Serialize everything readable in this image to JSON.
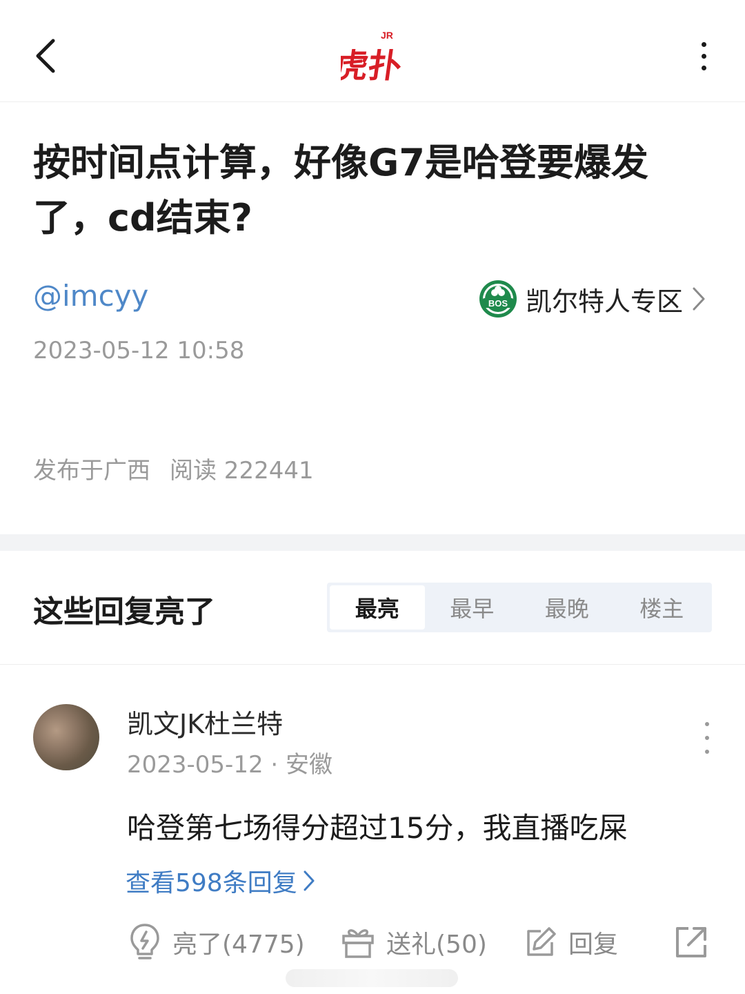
{
  "header": {
    "back_icon": "chevron-left-icon",
    "logo_text": "虎扑",
    "logo_superscript": "JR",
    "more_icon": "more-vertical-icon"
  },
  "post": {
    "title": "按时间点计算，好像G7是哈登要爆发了，cd结束?",
    "author": "@imcyy",
    "forum": {
      "name": "凯尔特人专区",
      "badge_text": "BOS"
    },
    "time": "2023-05-12 10:58",
    "location": "发布于广西",
    "views": "阅读 222441"
  },
  "replies_section": {
    "title": "这些回复亮了",
    "tabs": [
      {
        "label": "最亮",
        "active": true
      },
      {
        "label": "最早",
        "active": false
      },
      {
        "label": "最晚",
        "active": false
      },
      {
        "label": "楼主",
        "active": false
      }
    ]
  },
  "comment": {
    "username": "凯文JK杜兰特",
    "meta": "2023-05-12 · 安徽",
    "body": "哈登第七场得分超过15分，我直播吃屎",
    "view_replies": "查看598条回复",
    "actions": {
      "light": "亮了(4775)",
      "gift": "送礼(50)",
      "reply": "回复"
    }
  },
  "colors": {
    "brand_red": "#d81e26",
    "link_blue": "#3f7cc4",
    "author_blue": "#4f88c8",
    "muted_gray": "#9a9a9a",
    "badge_green": "#1f8a4c"
  }
}
